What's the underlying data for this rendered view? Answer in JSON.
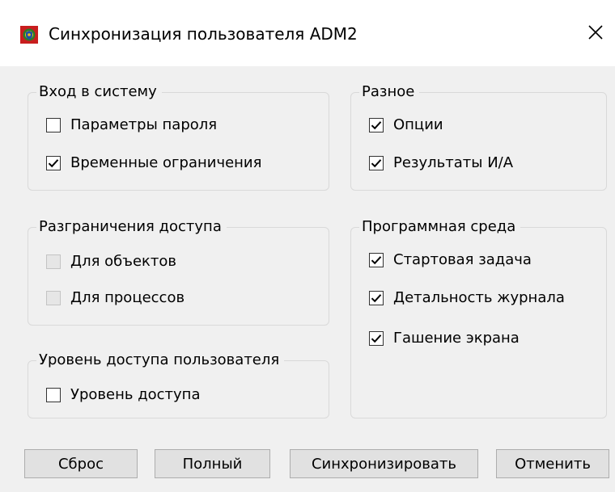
{
  "window": {
    "title": "Синхронизация пользователя ADM2",
    "app_icon": "app-shield-icon",
    "close_icon": "close-icon"
  },
  "groups": {
    "login": {
      "title": "Вход в систему",
      "items": [
        {
          "label": "Параметры пароля",
          "checked": false,
          "enabled": true
        },
        {
          "label": "Временные ограничения",
          "checked": true,
          "enabled": true
        }
      ]
    },
    "access": {
      "title": "Разграничения доступа",
      "items": [
        {
          "label": "Для объектов",
          "checked": false,
          "enabled": false
        },
        {
          "label": "Для процессов",
          "checked": false,
          "enabled": false
        }
      ]
    },
    "level": {
      "title": "Уровень доступа пользователя",
      "items": [
        {
          "label": "Уровень доступа",
          "checked": false,
          "enabled": true
        }
      ]
    },
    "misc": {
      "title": "Разное",
      "items": [
        {
          "label": "Опции",
          "checked": true,
          "enabled": true
        },
        {
          "label": "Результаты И/А",
          "checked": true,
          "enabled": true
        }
      ]
    },
    "env": {
      "title": "Программная среда",
      "items": [
        {
          "label": "Стартовая задача",
          "checked": true,
          "enabled": true
        },
        {
          "label": "Детальность журнала",
          "checked": true,
          "enabled": true
        },
        {
          "label": "Гашение экрана",
          "checked": true,
          "enabled": true
        }
      ]
    }
  },
  "buttons": {
    "reset": "Сброс",
    "full": "Полный",
    "sync": "Синхронизировать",
    "cancel": "Отменить"
  },
  "colors": {
    "titlebar": "#ffffff",
    "dialog_bg": "#f0f0f0",
    "button_bg": "#e1e1e1",
    "button_border": "#adadad",
    "group_border": "#d9d9d9"
  }
}
